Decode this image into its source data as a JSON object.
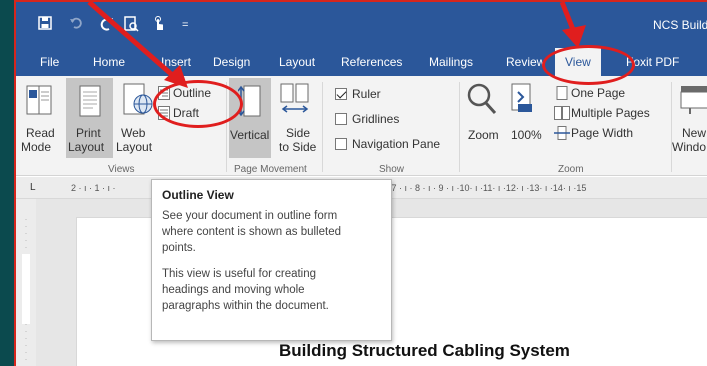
{
  "window": {
    "title": "NCS Build"
  },
  "quick_access": {
    "save_icon": "save-icon",
    "undo_icon": "undo-icon",
    "redo_icon": "redo-icon",
    "print_preview_icon": "print-preview-icon",
    "touch_icon": "touch-mode-icon",
    "customize_icon": "customize-icon"
  },
  "tabs": [
    {
      "label": "File"
    },
    {
      "label": "Home"
    },
    {
      "label": "Insert"
    },
    {
      "label": "Design"
    },
    {
      "label": "Layout"
    },
    {
      "label": "References"
    },
    {
      "label": "Mailings"
    },
    {
      "label": "Review"
    },
    {
      "label": "View",
      "active": true
    },
    {
      "label": "Foxit PDF"
    }
  ],
  "ribbon": {
    "views": {
      "group_label": "Views",
      "read_mode": [
        "Read",
        "Mode"
      ],
      "print_layout": [
        "Print",
        "Layout"
      ],
      "web_layout": [
        "Web",
        "Layout"
      ],
      "outline": "Outline",
      "draft": "Draft"
    },
    "page_movement": {
      "group_label": "Page Movement",
      "vertical": "Vertical",
      "side_to_side": [
        "Side",
        "to Side"
      ]
    },
    "show": {
      "group_label": "Show",
      "ruler": {
        "label": "Ruler",
        "checked": true
      },
      "gridlines": {
        "label": "Gridlines",
        "checked": false
      },
      "navigation_pane": {
        "label": "Navigation Pane",
        "checked": false
      }
    },
    "zoom": {
      "group_label": "Zoom",
      "zoom": "Zoom",
      "hundred": "100%",
      "one_page": "One Page",
      "multiple_pages": "Multiple Pages",
      "page_width": "Page Width"
    },
    "window": {
      "new_window": [
        "New",
        "Windo"
      ]
    }
  },
  "ruler": {
    "left_marker": "L",
    "left_ticks": "2 · ı · 1 · ı ·",
    "right_ticks": "ı · 7 · ı · 8 · ı · 9 · ı ·10· ı ·11· ı ·12· ı ·13· ı ·14· ı ·15"
  },
  "tooltip": {
    "title": "Outline View",
    "text1": "See your document in outline form\nwhere content is shown as bulleted\npoints.",
    "text2": "This view is useful for creating\nheadings and moving whole\nparagraphs within the document."
  },
  "document": {
    "heading": "Building Structured Cabling System"
  },
  "colors": {
    "title_bar": "#2b579a",
    "ribbon": "#f3f3f3",
    "annotation": "#e01e1e",
    "background": "#0b4a4e"
  }
}
